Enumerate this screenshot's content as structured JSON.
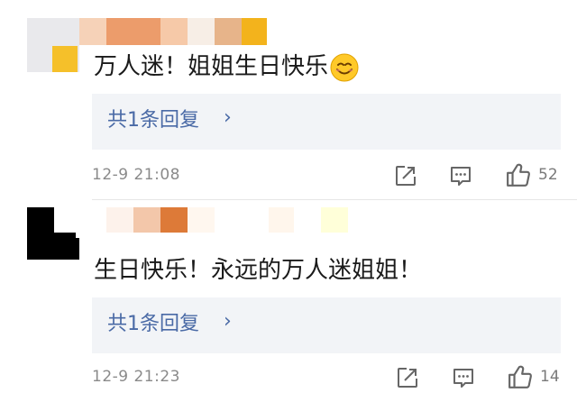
{
  "comments": [
    {
      "text": "万人迷！姐姐生日快乐",
      "reply_label": "共1条回复",
      "reply_chevron": "›",
      "time": "12-9  21:08",
      "likes": "52",
      "emoji": "smiling-face-icon"
    },
    {
      "text": "生日快乐！永远的万人迷姐姐！",
      "reply_label": "共1条回复",
      "reply_chevron": "›",
      "time": "12-9  21:23",
      "likes": "14"
    }
  ],
  "colors": {
    "link_blue": "#4a6aa6",
    "reply_bg": "#f2f4f7",
    "meta_gray": "#8a8a8a"
  }
}
